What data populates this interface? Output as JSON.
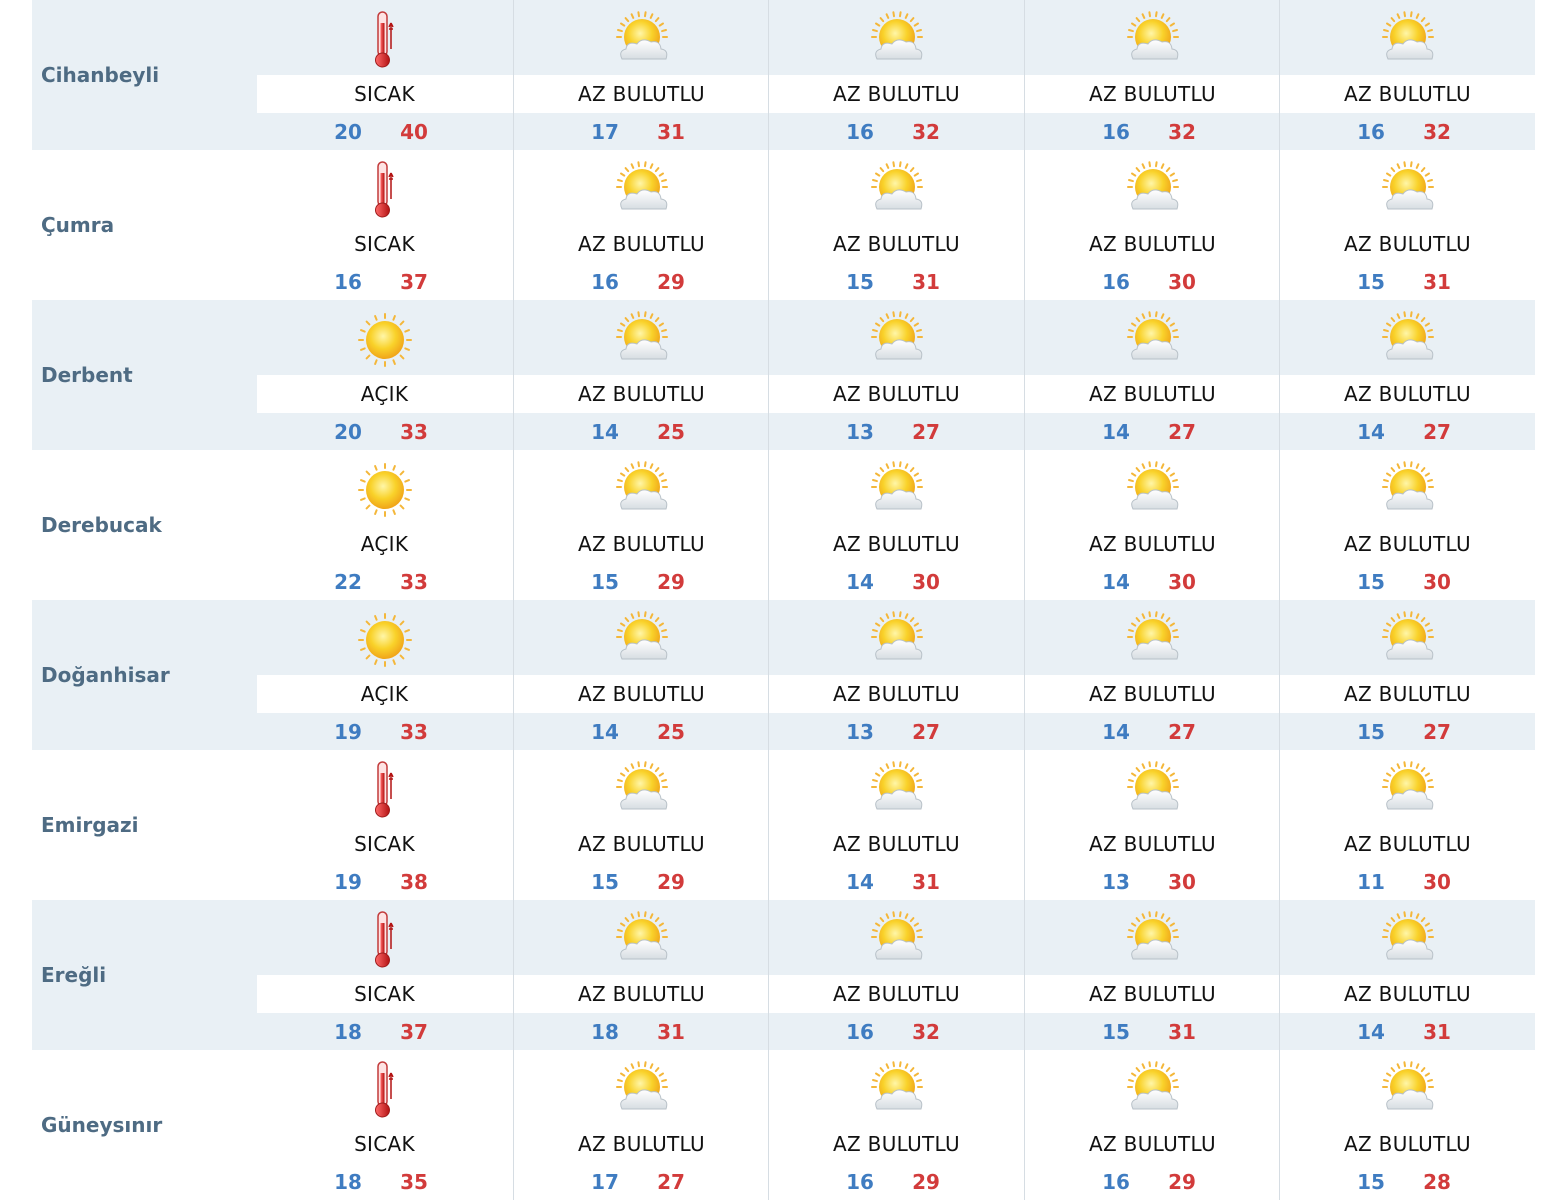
{
  "colors": {
    "min": "#3f7cc1",
    "max": "#d23b3b",
    "row_shade": "#e9f0f5",
    "district": "#4e6b83"
  },
  "rows": [
    {
      "district": "Cihanbeyli",
      "days": [
        {
          "icon": "thermometer-icon",
          "cond": "SICAK",
          "min": "20",
          "max": "40"
        },
        {
          "icon": "partly-cloudy-icon",
          "cond": "AZ BULUTLU",
          "min": "17",
          "max": "31"
        },
        {
          "icon": "partly-cloudy-icon",
          "cond": "AZ BULUTLU",
          "min": "16",
          "max": "32"
        },
        {
          "icon": "partly-cloudy-icon",
          "cond": "AZ BULUTLU",
          "min": "16",
          "max": "32"
        },
        {
          "icon": "partly-cloudy-icon",
          "cond": "AZ BULUTLU",
          "min": "16",
          "max": "32"
        }
      ]
    },
    {
      "district": "Çumra",
      "days": [
        {
          "icon": "thermometer-icon",
          "cond": "SICAK",
          "min": "16",
          "max": "37"
        },
        {
          "icon": "partly-cloudy-icon",
          "cond": "AZ BULUTLU",
          "min": "16",
          "max": "29"
        },
        {
          "icon": "partly-cloudy-icon",
          "cond": "AZ BULUTLU",
          "min": "15",
          "max": "31"
        },
        {
          "icon": "partly-cloudy-icon",
          "cond": "AZ BULUTLU",
          "min": "16",
          "max": "30"
        },
        {
          "icon": "partly-cloudy-icon",
          "cond": "AZ BULUTLU",
          "min": "15",
          "max": "31"
        }
      ]
    },
    {
      "district": "Derbent",
      "days": [
        {
          "icon": "sun-icon",
          "cond": "AÇIK",
          "min": "20",
          "max": "33"
        },
        {
          "icon": "partly-cloudy-icon",
          "cond": "AZ BULUTLU",
          "min": "14",
          "max": "25"
        },
        {
          "icon": "partly-cloudy-icon",
          "cond": "AZ BULUTLU",
          "min": "13",
          "max": "27"
        },
        {
          "icon": "partly-cloudy-icon",
          "cond": "AZ BULUTLU",
          "min": "14",
          "max": "27"
        },
        {
          "icon": "partly-cloudy-icon",
          "cond": "AZ BULUTLU",
          "min": "14",
          "max": "27"
        }
      ]
    },
    {
      "district": "Derebucak",
      "days": [
        {
          "icon": "sun-icon",
          "cond": "AÇIK",
          "min": "22",
          "max": "33"
        },
        {
          "icon": "partly-cloudy-icon",
          "cond": "AZ BULUTLU",
          "min": "15",
          "max": "29"
        },
        {
          "icon": "partly-cloudy-icon",
          "cond": "AZ BULUTLU",
          "min": "14",
          "max": "30"
        },
        {
          "icon": "partly-cloudy-icon",
          "cond": "AZ BULUTLU",
          "min": "14",
          "max": "30"
        },
        {
          "icon": "partly-cloudy-icon",
          "cond": "AZ BULUTLU",
          "min": "15",
          "max": "30"
        }
      ]
    },
    {
      "district": "Doğanhisar",
      "days": [
        {
          "icon": "sun-icon",
          "cond": "AÇIK",
          "min": "19",
          "max": "33"
        },
        {
          "icon": "partly-cloudy-icon",
          "cond": "AZ BULUTLU",
          "min": "14",
          "max": "25"
        },
        {
          "icon": "partly-cloudy-icon",
          "cond": "AZ BULUTLU",
          "min": "13",
          "max": "27"
        },
        {
          "icon": "partly-cloudy-icon",
          "cond": "AZ BULUTLU",
          "min": "14",
          "max": "27"
        },
        {
          "icon": "partly-cloudy-icon",
          "cond": "AZ BULUTLU",
          "min": "15",
          "max": "27"
        }
      ]
    },
    {
      "district": "Emirgazi",
      "days": [
        {
          "icon": "thermometer-icon",
          "cond": "SICAK",
          "min": "19",
          "max": "38"
        },
        {
          "icon": "partly-cloudy-icon",
          "cond": "AZ BULUTLU",
          "min": "15",
          "max": "29"
        },
        {
          "icon": "partly-cloudy-icon",
          "cond": "AZ BULUTLU",
          "min": "14",
          "max": "31"
        },
        {
          "icon": "partly-cloudy-icon",
          "cond": "AZ BULUTLU",
          "min": "13",
          "max": "30"
        },
        {
          "icon": "partly-cloudy-icon",
          "cond": "AZ BULUTLU",
          "min": "11",
          "max": "30"
        }
      ]
    },
    {
      "district": "Ereğli",
      "days": [
        {
          "icon": "thermometer-icon",
          "cond": "SICAK",
          "min": "18",
          "max": "37"
        },
        {
          "icon": "partly-cloudy-icon",
          "cond": "AZ BULUTLU",
          "min": "18",
          "max": "31"
        },
        {
          "icon": "partly-cloudy-icon",
          "cond": "AZ BULUTLU",
          "min": "16",
          "max": "32"
        },
        {
          "icon": "partly-cloudy-icon",
          "cond": "AZ BULUTLU",
          "min": "15",
          "max": "31"
        },
        {
          "icon": "partly-cloudy-icon",
          "cond": "AZ BULUTLU",
          "min": "14",
          "max": "31"
        }
      ]
    },
    {
      "district": "Güneysınır",
      "days": [
        {
          "icon": "thermometer-icon",
          "cond": "SICAK",
          "min": "18",
          "max": "35"
        },
        {
          "icon": "partly-cloudy-icon",
          "cond": "AZ BULUTLU",
          "min": "17",
          "max": "27"
        },
        {
          "icon": "partly-cloudy-icon",
          "cond": "AZ BULUTLU",
          "min": "16",
          "max": "29"
        },
        {
          "icon": "partly-cloudy-icon",
          "cond": "AZ BULUTLU",
          "min": "16",
          "max": "29"
        },
        {
          "icon": "partly-cloudy-icon",
          "cond": "AZ BULUTLU",
          "min": "15",
          "max": "28"
        }
      ]
    }
  ]
}
